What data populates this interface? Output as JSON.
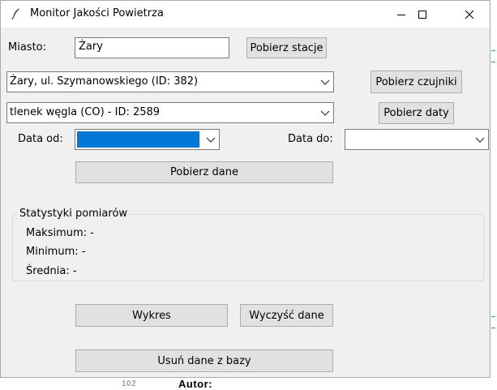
{
  "window": {
    "title": "Monitor Jakości Powietrza"
  },
  "city": {
    "label": "Miasto:",
    "value": "Żary",
    "fetch_button": "Pobierz stacje"
  },
  "station": {
    "selected": "Żary, ul. Szymanowskiego  (ID: 382)",
    "fetch_button": "Pobierz czujniki"
  },
  "sensor": {
    "selected": "tlenek węgla (CO) - ID: 2589",
    "fetch_button": "Pobierz daty"
  },
  "dates": {
    "from_label": "Data od:",
    "from_value": "",
    "to_label": "Data do:",
    "to_value": ""
  },
  "fetch_data_button": "Pobierz dane",
  "stats": {
    "title": "Statystyki pomiarów",
    "max": "Maksimum: -",
    "min": "Minimum: -",
    "avg": "Średnia: -"
  },
  "actions": {
    "chart": "Wykres",
    "clear": "Wyczyść dane",
    "delete_db": "Usuń dane z bazy"
  },
  "background": {
    "text": "Autor:",
    "line_number": "102"
  },
  "colors": {
    "selection": "#0078d7",
    "window_bg": "#f0f0f0",
    "button_bg": "#e1e1e1"
  },
  "icons": {
    "app": "feather-icon",
    "minimize": "minimize-icon",
    "maximize": "maximize-icon",
    "close": "close-icon",
    "dropdown": "chevron-down-icon"
  }
}
